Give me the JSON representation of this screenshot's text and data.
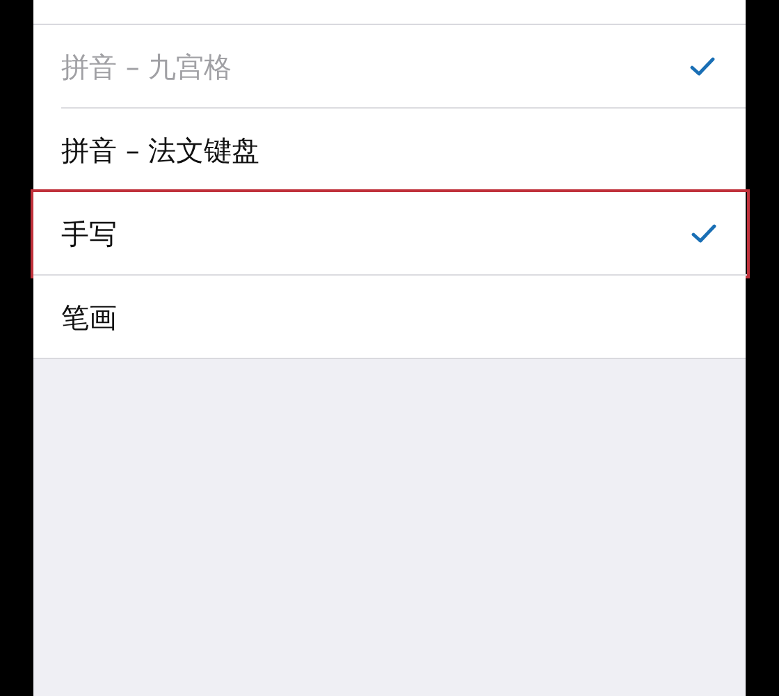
{
  "keyboards": [
    {
      "label": "拼音 – 九宫格",
      "checked": true,
      "disabled": true,
      "highlighted": false
    },
    {
      "label": "拼音 – 法文键盘",
      "checked": false,
      "disabled": false,
      "highlighted": false
    },
    {
      "label": "手写",
      "checked": true,
      "disabled": false,
      "highlighted": true
    },
    {
      "label": "笔画",
      "checked": false,
      "disabled": false,
      "highlighted": false
    }
  ]
}
